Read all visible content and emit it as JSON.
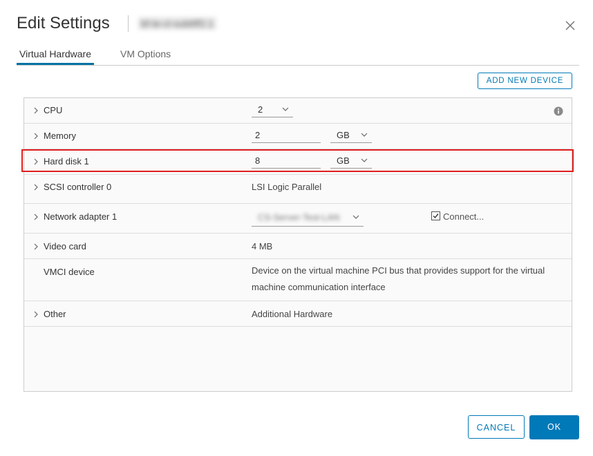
{
  "dialog": {
    "title": "Edit Settings",
    "vm_name": "bf-te-cl-sub6ff2.1",
    "close_icon": "close-icon"
  },
  "tabs": [
    {
      "label": "Virtual Hardware",
      "active": true
    },
    {
      "label": "VM Options",
      "active": false
    }
  ],
  "toolbar": {
    "add_device_label": "ADD NEW DEVICE"
  },
  "hardware": {
    "cpu": {
      "label": "CPU",
      "value": "2"
    },
    "memory": {
      "label": "Memory",
      "value": "2",
      "unit": "GB"
    },
    "hard_disk": {
      "label": "Hard disk 1",
      "value": "8",
      "unit": "GB"
    },
    "scsi": {
      "label": "SCSI controller 0",
      "value": "LSI Logic Parallel"
    },
    "network": {
      "label": "Network adapter 1",
      "value": "CS-Server-Test-LAN",
      "connect_label": "Connect...",
      "connected": true
    },
    "video": {
      "label": "Video card",
      "value": "4 MB"
    },
    "vmci": {
      "label": "VMCI device",
      "value": "Device on the virtual machine PCI bus that provides support for the virtual machine communication interface"
    },
    "other": {
      "label": "Other",
      "value": "Additional Hardware"
    }
  },
  "footer": {
    "cancel_label": "CANCEL",
    "ok_label": "OK"
  },
  "colors": {
    "accent": "#0079b8",
    "highlight": "#e01e1e"
  }
}
